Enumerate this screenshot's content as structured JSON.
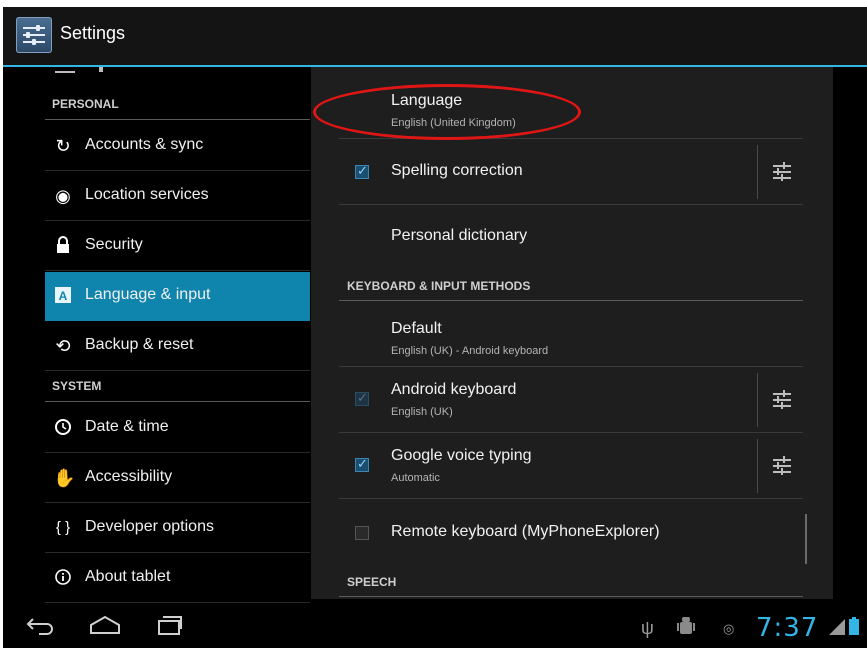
{
  "actionbar": {
    "title": "Settings",
    "icon": "settings-sliders-icon"
  },
  "sidebar": {
    "sections": [
      {
        "label": "PERSONAL"
      },
      {
        "label": "SYSTEM"
      }
    ],
    "items": [
      {
        "label": "Accounts & sync",
        "icon": "sync-icon",
        "selected": false
      },
      {
        "label": "Location services",
        "icon": "location-icon",
        "selected": false
      },
      {
        "label": "Security",
        "icon": "lock-icon",
        "selected": false
      },
      {
        "label": "Language & input",
        "icon": "language-icon",
        "selected": true
      },
      {
        "label": "Backup & reset",
        "icon": "backup-icon",
        "selected": false
      },
      {
        "label": "Date & time",
        "icon": "clock-icon",
        "selected": false
      },
      {
        "label": "Accessibility",
        "icon": "hand-icon",
        "selected": false
      },
      {
        "label": "Developer options",
        "icon": "braces-icon",
        "selected": false
      },
      {
        "label": "About tablet",
        "icon": "info-icon",
        "selected": false
      }
    ],
    "accent": "#0f84ad"
  },
  "detail": {
    "language": {
      "title": "Language",
      "summary": "English (United Kingdom)"
    },
    "spelling": {
      "title": "Spelling correction",
      "checked": true
    },
    "dictionary": {
      "title": "Personal dictionary"
    },
    "category_keyboard": "KEYBOARD & INPUT METHODS",
    "default": {
      "title": "Default",
      "summary": "English (UK) - Android keyboard"
    },
    "android_keyboard": {
      "title": "Android keyboard",
      "summary": "English (UK)",
      "checked": true,
      "enabled": false
    },
    "voice_typing": {
      "title": "Google voice typing",
      "summary": "Automatic",
      "checked": true
    },
    "remote_keyboard": {
      "title": "Remote keyboard (MyPhoneExplorer)",
      "checked": false
    },
    "category_speech": "SPEECH"
  },
  "statusbar": {
    "time": "7:37",
    "time_color": "#33b5e5",
    "icons": [
      "usb-icon",
      "android-debug-icon",
      "sync-status-icon",
      "signal-icon",
      "battery-icon"
    ]
  },
  "annotation": {
    "color": "#e01616"
  }
}
